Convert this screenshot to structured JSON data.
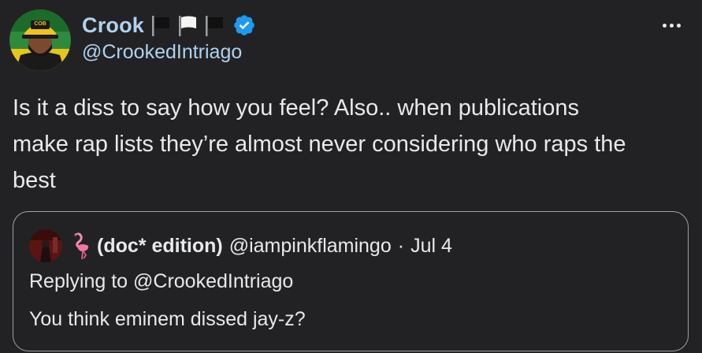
{
  "author": {
    "display_name": "Crook",
    "handle": "@CrookedIntriago",
    "flags": [
      "black-flag-icon",
      "white-flag-icon",
      "black-flag-icon"
    ],
    "verified_icon": "verified-badge-icon",
    "avatar_icon": "profile-avatar",
    "avatar_cap_text": "COB"
  },
  "more_icon": "more-options-icon",
  "tweet": {
    "lines": [
      "Is it a diss to say how you feel? Also.. when publications",
      "make rap lists they’re almost never considering who raps the",
      "best"
    ]
  },
  "quoted": {
    "avatar_icon": "quoted-avatar",
    "emoji_icon": "flamingo-icon",
    "display_name": "(doc* edition)",
    "handle": "@iampinkflamingo",
    "separator": "·",
    "date": "Jul 4",
    "replying_to": "Replying to @CrookedIntriago",
    "text": "You think eminem dissed jay-z?"
  },
  "colors": {
    "background": "#222224",
    "name_blue": "#b0d2ee",
    "verified_blue": "#1d9bf0",
    "text": "#e7e9ea",
    "quote_border": "#9aa1a8"
  }
}
